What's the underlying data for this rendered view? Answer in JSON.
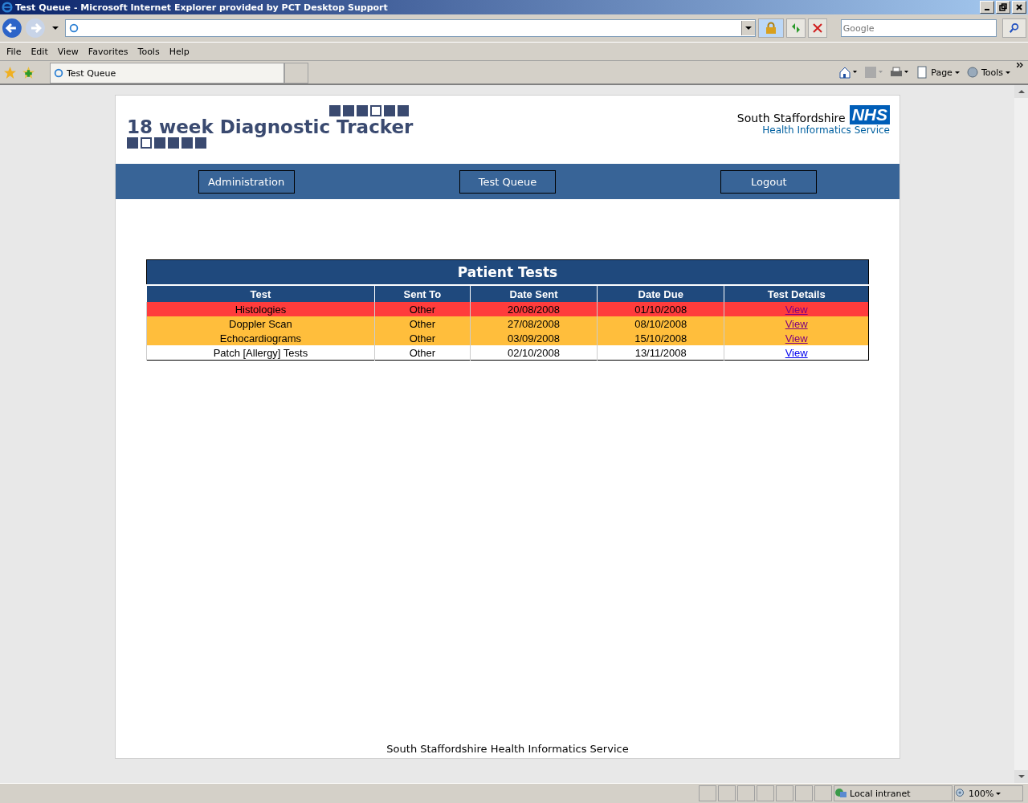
{
  "window": {
    "title": "Test Queue - Microsoft Internet Explorer provided by PCT Desktop Support"
  },
  "search": {
    "placeholder": "Google"
  },
  "menu": [
    "File",
    "Edit",
    "View",
    "Favorites",
    "Tools",
    "Help"
  ],
  "tabs": [
    {
      "label": "Test Queue",
      "selected": true
    }
  ],
  "command_bar": [
    "Page",
    "Tools"
  ],
  "header": {
    "title": "18 week Diagnostic Tracker",
    "org_line1": "South Staffordshire",
    "org_badge": "NHS",
    "org_line2": "Health Informatics Service"
  },
  "nav": [
    "Administration",
    "Test Queue",
    "Logout"
  ],
  "table": {
    "title": "Patient Tests",
    "columns": [
      "Test",
      "Sent To",
      "Date Sent",
      "Date Due",
      "Test Details"
    ],
    "rows": [
      {
        "cells": [
          "Histologies",
          "Other",
          "20/08/2008",
          "01/10/2008"
        ],
        "link": "View",
        "visited": true,
        "color": "#ff3c3c"
      },
      {
        "cells": [
          "Doppler Scan",
          "Other",
          "27/08/2008",
          "08/10/2008"
        ],
        "link": "View",
        "visited": true,
        "color": "#ffbe3c"
      },
      {
        "cells": [
          "Echocardiograms",
          "Other",
          "03/09/2008",
          "15/10/2008"
        ],
        "link": "View",
        "visited": true,
        "color": "#ffbe3c"
      },
      {
        "cells": [
          "Patch [Allergy] Tests",
          "Other",
          "02/10/2008",
          "13/11/2008"
        ],
        "link": "View",
        "visited": false,
        "color": "#ffffff"
      }
    ]
  },
  "footer": "South Staffordshire Health Informatics Service",
  "status_bar": {
    "zone": "Local intranet",
    "zoom": "100%"
  }
}
